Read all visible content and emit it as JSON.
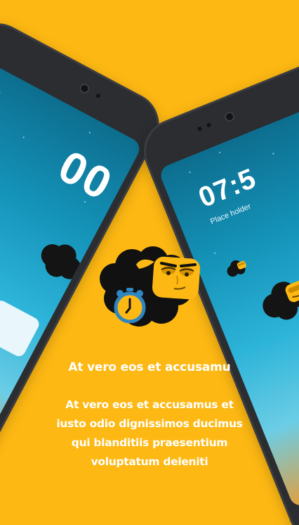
{
  "colors": {
    "background": "#FDB813",
    "phone_frame": "#2b2d31",
    "text": "#ffffff"
  },
  "phone_left": {
    "clock": "00"
  },
  "phone_right": {
    "clock": "07:5",
    "subtitle": "Place holder"
  },
  "mascot": {
    "icons": [
      "sheep-icon",
      "alarm-clock-icon"
    ]
  },
  "onboarding": {
    "title": "At vero eos et accusamu",
    "description": "At vero eos et accusamus et iusto odio dignissimos ducimus qui blanditiis praesentium voluptatum deleniti"
  }
}
